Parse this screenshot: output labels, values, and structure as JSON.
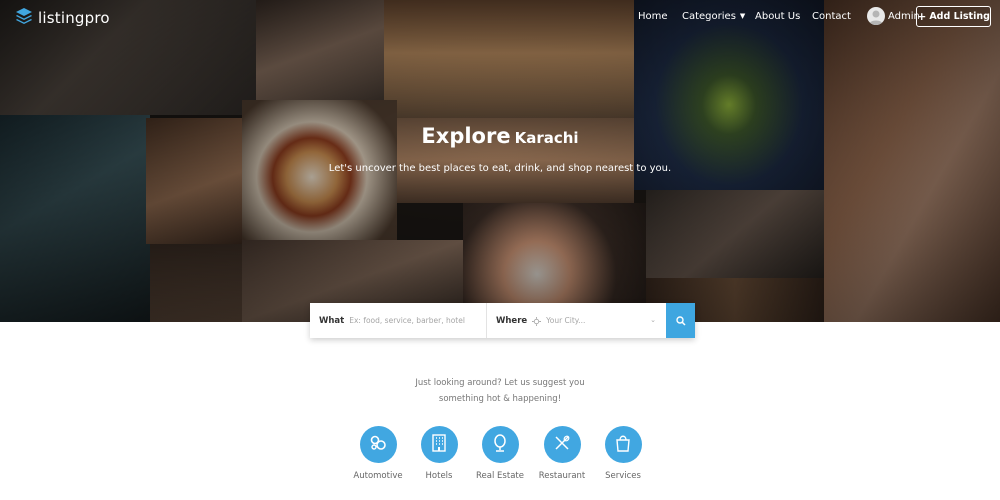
{
  "brand": {
    "name": "listingpro",
    "accent": "#41a7e1",
    "logo_icon": "stacked-layers-icon"
  },
  "nav": {
    "items": [
      {
        "label": "Home"
      },
      {
        "label": "Categories",
        "has_dropdown": true
      },
      {
        "label": "About Us"
      },
      {
        "label": "Contact"
      }
    ],
    "user_label": "Admin",
    "add_listing_label": "Add Listing"
  },
  "hero": {
    "headline": "Explore",
    "city": "Karachi",
    "subtitle": "Let's uncover the best places to eat, drink, and shop nearest to you."
  },
  "search": {
    "what_label": "What",
    "what_placeholder": "Ex: food, service, barber, hotel",
    "where_label": "Where",
    "where_placeholder": "Your City...",
    "button_icon": "search-icon"
  },
  "suggest": {
    "line1": "Just looking around? Let us suggest you",
    "line2": "something hot & happening!"
  },
  "categories": [
    {
      "label": "Automotive",
      "icon": "gears-icon"
    },
    {
      "label": "Hotels",
      "icon": "building-icon"
    },
    {
      "label": "Real Estate",
      "icon": "mirror-icon"
    },
    {
      "label": "Restaurant",
      "icon": "fork-spoon-icon"
    },
    {
      "label": "Services",
      "icon": "shopping-bag-icon"
    }
  ]
}
